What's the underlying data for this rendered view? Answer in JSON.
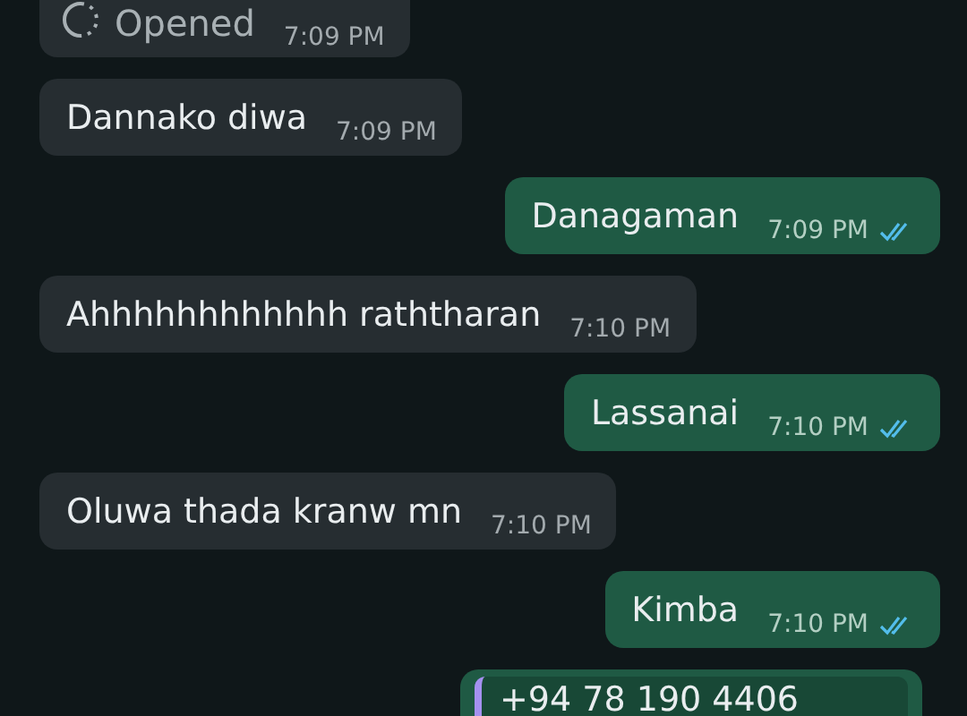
{
  "messages": [
    {
      "kind": "view_once",
      "outgoing": false,
      "text": "Opened",
      "time": "7:09 PM"
    },
    {
      "kind": "text",
      "outgoing": false,
      "text": "Dannako diwa",
      "time": "7:09 PM"
    },
    {
      "kind": "text",
      "outgoing": true,
      "text": "Danagaman",
      "time": "7:09 PM",
      "read": true
    },
    {
      "kind": "text",
      "outgoing": false,
      "text": "Ahhhhhhhhhhhh raththaran",
      "time": "7:10 PM"
    },
    {
      "kind": "text",
      "outgoing": true,
      "text": "Lassanai",
      "time": "7:10 PM",
      "read": true
    },
    {
      "kind": "text",
      "outgoing": false,
      "text": "Oluwa thada kranw mn",
      "time": "7:10 PM"
    },
    {
      "kind": "text",
      "outgoing": true,
      "text": "Kimba",
      "time": "7:10 PM",
      "read": true
    },
    {
      "kind": "quote",
      "outgoing": true,
      "text": "+94 78 190 4406"
    }
  ]
}
